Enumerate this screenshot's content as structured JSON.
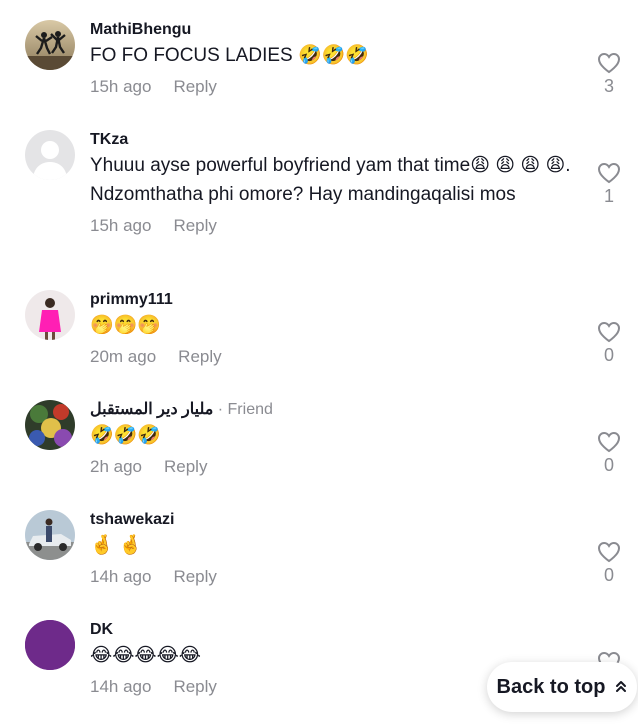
{
  "comments": [
    {
      "username": "MathiBhengu",
      "friend": "",
      "text": "FO FO FOCUS LADIES 🤣🤣🤣",
      "time": "15h ago",
      "reply": "Reply",
      "likes": "3",
      "avatar": "silhouette-avatar"
    },
    {
      "username": "TKza",
      "friend": "",
      "text": "Yhuuu ayse powerful boyfriend yam that time😩 😩 😩 😩. Ndzomthatha phi omore? Hay mandingaqalisi mos",
      "time": "15h ago",
      "reply": "Reply",
      "likes": "1",
      "avatar": "default-avatar"
    },
    {
      "username": "primmy111",
      "friend": "",
      "text": "🤭🤭🤭",
      "time": "20m ago",
      "reply": "Reply",
      "likes": "0",
      "avatar": "pink-dress-avatar"
    },
    {
      "username": "مليار دير المستقبل",
      "friend": " · Friend",
      "text": "🤣🤣🤣",
      "time": "2h ago",
      "reply": "Reply",
      "likes": "0",
      "avatar": "colorful-avatar"
    },
    {
      "username": "tshawekazi",
      "friend": "",
      "text": "🤞 🤞",
      "time": "14h ago",
      "reply": "Reply",
      "likes": "0",
      "avatar": "car-avatar"
    },
    {
      "username": "DK",
      "friend": "",
      "text": "😂😂😂😂😂",
      "time": "14h ago",
      "reply": "Reply",
      "likes": "",
      "avatar": "purple-avatar"
    }
  ],
  "back_to_top": "Back to top",
  "colors": {
    "text": "#161823",
    "muted": "#8a8b91",
    "purple_avatar": "#6e2a8a",
    "pink_avatar": "#ff1fb4"
  }
}
